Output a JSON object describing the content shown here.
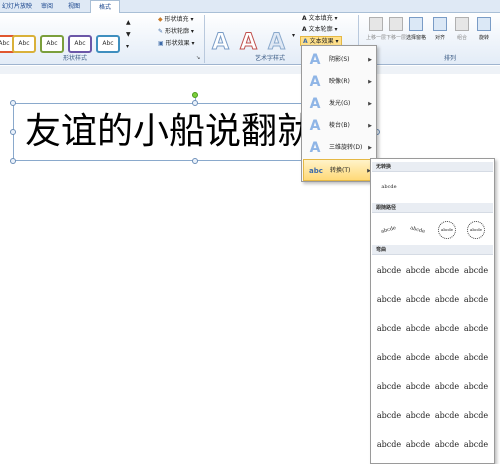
{
  "tabs": [
    "幻灯片放映",
    "审阅",
    "视图",
    "格式"
  ],
  "ribbon": {
    "shape_styles": [
      "Abc",
      "Abc",
      "Abc",
      "Abc",
      "Abc"
    ],
    "shape_style_colors": [
      "#e0572f",
      "#d9b13a",
      "#7b9f3c",
      "#6b57a8",
      "#3f8fbf"
    ],
    "shape_commands": [
      "形状填充",
      "形状轮廓",
      "形状效果"
    ],
    "wordart_letters": [
      "A",
      "A",
      "A"
    ],
    "text_commands": [
      "文本填充",
      "文本轮廓",
      "文本效果"
    ],
    "arrange_buttons": [
      "上移一层",
      "下移一层",
      "选择窗格",
      "对齐",
      "组合",
      "旋转"
    ],
    "group_labels": [
      "形状样式",
      "艺术字样式",
      "排列"
    ]
  },
  "slide": {
    "text": "友谊的小船说翻就翻"
  },
  "effects_menu": {
    "items": [
      {
        "label": "阴影(S)",
        "icon": "A"
      },
      {
        "label": "映像(R)",
        "icon": "A"
      },
      {
        "label": "发光(G)",
        "icon": "A"
      },
      {
        "label": "棱台(B)",
        "icon": "A"
      },
      {
        "label": "三维旋转(D)",
        "icon": "A"
      },
      {
        "label": "转换(T)",
        "icon": "abc"
      }
    ]
  },
  "transform_submenu": {
    "no_transform": "无转换",
    "sample": "abcde",
    "follow_path": "跟随路径",
    "warp": "弯曲",
    "sample_short": "abcde"
  }
}
